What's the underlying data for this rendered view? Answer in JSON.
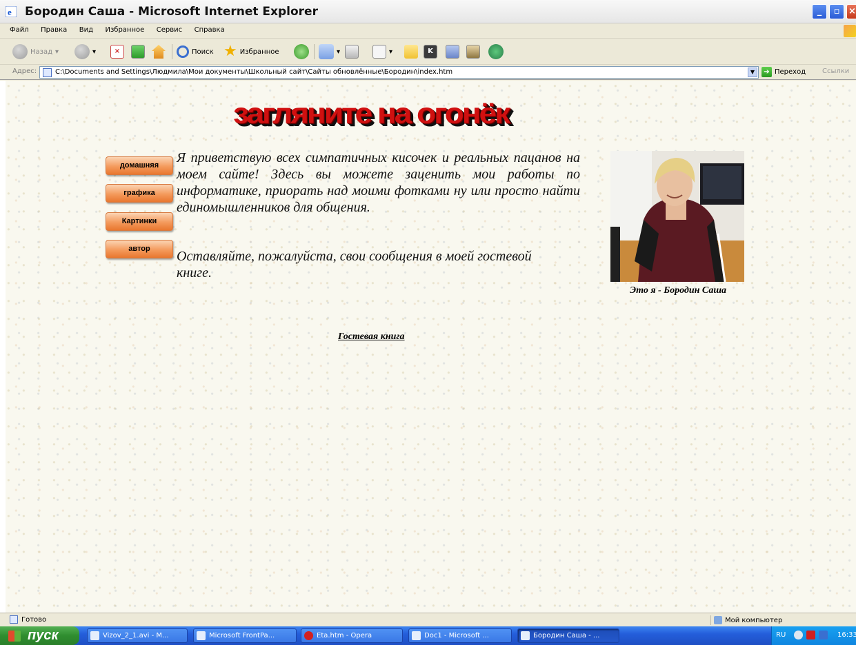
{
  "window": {
    "title": "Бородин Саша - Microsoft Internet Explorer"
  },
  "menu": [
    "Файл",
    "Правка",
    "Вид",
    "Избранное",
    "Сервис",
    "Справка"
  ],
  "toolbar": {
    "back_label": "Назад",
    "search_label": "Поиск",
    "favorites_label": "Избранное"
  },
  "address": {
    "label": "Адрес:",
    "url": "C:\\Documents and Settings\\Людмила\\Мои документы\\Школьный сайт\\Сайты обновлённые\\Бородин\\index.htm",
    "go_label": "Переход",
    "links_label": "Ссылки"
  },
  "page": {
    "banner": "загляните на огонёк",
    "nav": [
      {
        "label": "домашняя"
      },
      {
        "label": "графика"
      },
      {
        "label": "Картинки"
      },
      {
        "label": "автор"
      }
    ],
    "intro": "Я приветствую всех симпатичных кисочек и реальных пацанов на моем сайте! Здесь вы можете заценить мои работы по информатике, приорать над моими фотками ну или просто найти единомышленников для общения.",
    "intro2": "Оставляйте, пожалуйста, свои сообщения в моей гостевой книге.",
    "caption": "Это я - Бородин Саша",
    "guestbook_link": "Гостевая книга"
  },
  "status": {
    "text": "Готово",
    "zone": "Мой компьютер"
  },
  "taskbar": {
    "start_label": "пуск",
    "tasks": [
      {
        "label": "Vizov_2_1.avi - M..."
      },
      {
        "label": "Microsoft FrontPa..."
      },
      {
        "label": "Eta.htm - Opera"
      },
      {
        "label": "Doc1 - Microsoft ..."
      },
      {
        "label": "Бородин Саша - ..."
      }
    ],
    "lang": "RU",
    "clock": "16:33"
  }
}
